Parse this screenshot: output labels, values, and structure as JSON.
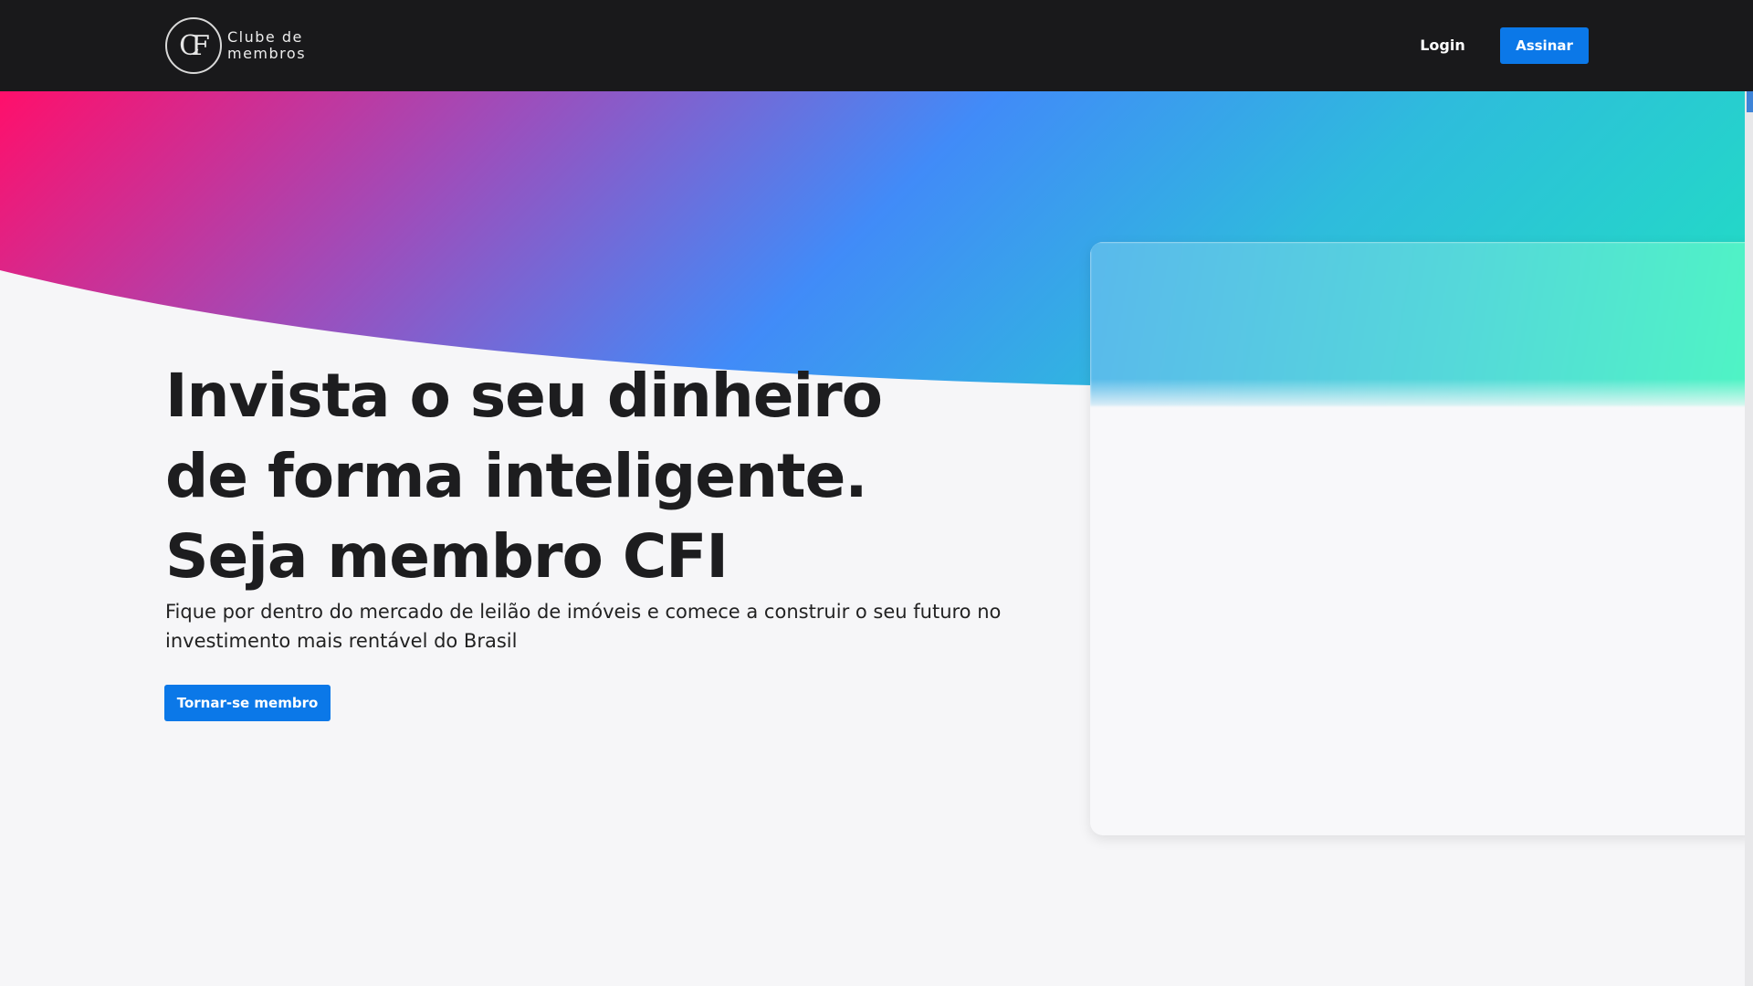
{
  "header": {
    "logo": {
      "mark": "CF",
      "line1": "Clube de",
      "line2": "membros"
    },
    "login_label": "Login",
    "subscribe_label": "Assinar"
  },
  "hero": {
    "headline": "Invista o seu dinheiro de forma inteligente. Seja membro CFI",
    "subtext": "Fique por dentro do mercado de leilão de imóveis e comece a construir o seu futuro no investimento mais rentável do Brasil",
    "cta_label": "Tornar-se membro"
  },
  "colors": {
    "header_bg": "#19191b",
    "accent": "#0b78e8",
    "gradient": [
      "#ff0f6b",
      "#9b4fbd",
      "#418bf8",
      "#2ebcdc",
      "#1fe3c0"
    ]
  },
  "icons": {
    "logo": "cf-monogram-icon"
  }
}
